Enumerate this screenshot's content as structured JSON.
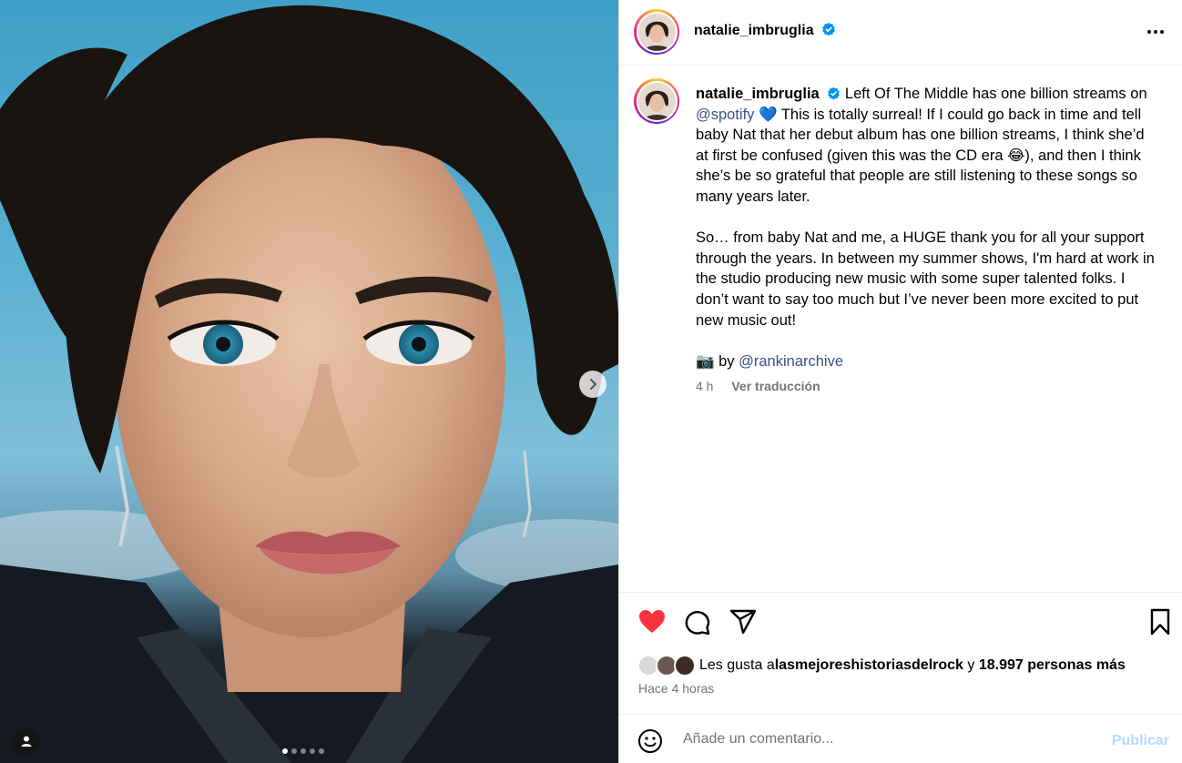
{
  "post": {
    "username": "natalie_imbruglia",
    "verified": true,
    "more_icon": "ellipsis-icon",
    "media": {
      "carousel_count": 5,
      "active_index": 0,
      "next_icon": "chevron-right-icon",
      "tag_icon": "user-icon"
    },
    "caption": {
      "username": "natalie_imbruglia",
      "line1_a": "Left Of The Middle has one billion streams on ",
      "mention1": "@spotify",
      "line1_b": " 💙 This is totally surreal! If I could go back in time and tell baby Nat that her debut album has one billion streams, I think she’d at first be confused (given this was the CD era 😂), and then I think she’s be so grateful that people are still listening to these songs so many years later.",
      "para2": "So… from baby Nat and me, a HUGE thank you for all your support through the years. In between my summer shows, I'm hard at work in the studio producing new music with some super talented folks. I don’t want to say too much but I’ve never been more excited to put new music out!",
      "credit_prefix": "📷 by ",
      "mention2": "@rankinarchive"
    },
    "meta": {
      "age": "4 h",
      "translate_label": "Ver traducción"
    },
    "actions": {
      "liked": true,
      "like_icon": "heart-icon",
      "comment_icon": "comment-icon",
      "share_icon": "send-icon",
      "save_icon": "bookmark-icon",
      "like_color": "#ff3040"
    },
    "likes": {
      "prefix": "Les gusta a ",
      "user": "lasmejoreshistoriasdelrock",
      "middle": " y ",
      "others": "18.997 personas más"
    },
    "time_ago": "Hace 4 horas",
    "comment": {
      "placeholder": "Añade un comentario...",
      "post_label": "Publicar",
      "emoji_icon": "smiley-icon"
    }
  }
}
